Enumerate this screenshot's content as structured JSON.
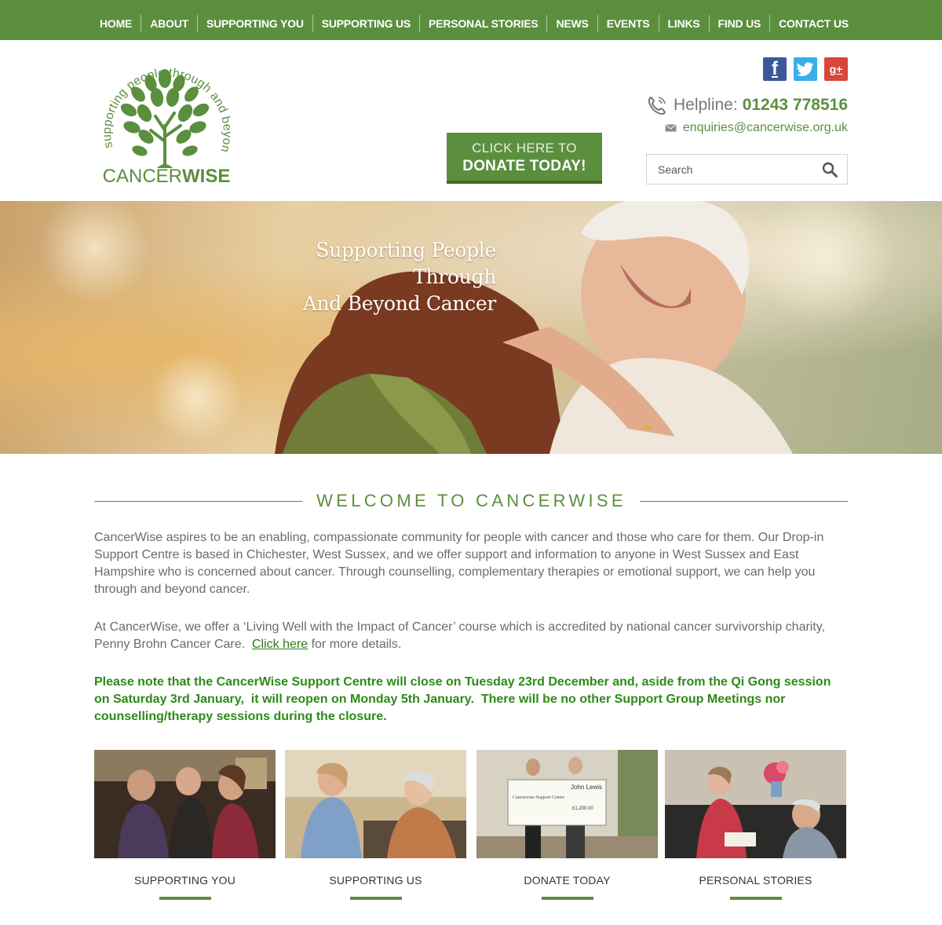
{
  "nav": {
    "items": [
      {
        "label": "HOME"
      },
      {
        "label": "ABOUT"
      },
      {
        "label": "SUPPORTING YOU"
      },
      {
        "label": "SUPPORTING US"
      },
      {
        "label": "PERSONAL STORIES"
      },
      {
        "label": "NEWS"
      },
      {
        "label": "EVENTS"
      },
      {
        "label": "LINKS"
      },
      {
        "label": "FIND US"
      },
      {
        "label": "CONTACT US"
      }
    ]
  },
  "header": {
    "logo_arc_text": "supporting people through and beyond cancer",
    "logo_name_light": "CANCER",
    "logo_name_bold": "WISE",
    "donate_line1": "CLICK HERE TO",
    "donate_line2": "DONATE TODAY!",
    "social": {
      "facebook_icon": "f",
      "twitter_icon": "t",
      "googleplus_icon": "g+"
    },
    "helpline_label": "Helpline:",
    "helpline_number": "01243 778516",
    "email": "enquiries@cancerwise.org.uk",
    "search_placeholder": "Search"
  },
  "hero": {
    "title_line1": "Supporting People Through",
    "title_line2": "And Beyond Cancer"
  },
  "welcome": {
    "heading": "WELCOME TO CANCERWISE",
    "p1": "CancerWise aspires to be an enabling, compassionate community for people with cancer and those who care for them. Our Drop-in Support Centre is based in Chichester, West Sussex, and we offer support and information to anyone in West Sussex and East Hampshire who is concerned about cancer. Through counselling, complementary therapies or emotional support, we can help you through and beyond cancer.",
    "p2_before": "At CancerWise, we offer a ‘Living Well with the Impact of Cancer’ course which is accredited by national cancer survivorship charity, Penny Brohn Cancer Care.  ",
    "p2_link": "Click here",
    "p2_after": " for more details.",
    "notice": "Please note that the CancerWise Support Centre will close on Tuesday 23rd December and, aside from the Qi Gong session on Saturday 3rd January,  it will reopen on Monday 5th January.  There will be no other Support Group Meetings nor counselling/therapy sessions during the closure."
  },
  "tiles": [
    {
      "caption": "SUPPORTING YOU"
    },
    {
      "caption": "SUPPORTING US"
    },
    {
      "caption": "DONATE TODAY"
    },
    {
      "caption": "PERSONAL STORIES"
    }
  ],
  "tile3_cheque": {
    "brand": "John Lewis",
    "payee": "Cancerwise Support Centre",
    "amount": "£1,200.00"
  },
  "colors": {
    "brand_green": "#5b8f3e",
    "notice_green": "#2d8a19",
    "text_grey": "#6b6b6b"
  }
}
